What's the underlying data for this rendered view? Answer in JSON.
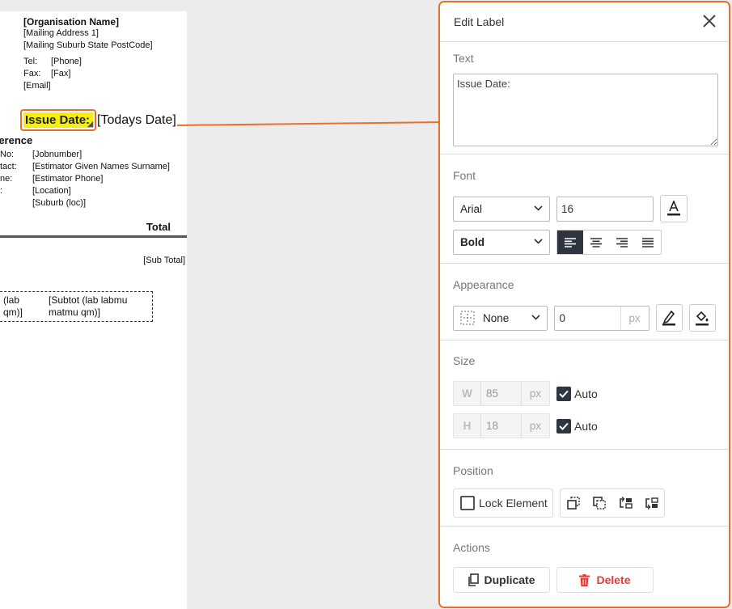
{
  "document": {
    "org_name": "[Organisation Name]",
    "address1": "[Mailing Address 1]",
    "address2": "[Mailing Suburb State PostCode]",
    "tel_label": "Tel:",
    "tel_value": "[Phone]",
    "fax_label": "Fax:",
    "fax_value": "[Fax]",
    "email": "[Email]",
    "issue_label": "Issue Date:",
    "todays_date": "[Todays Date]",
    "reference_title": "ference",
    "reference_rows": [
      {
        "label": "No:",
        "value": "[Jobnumber]"
      },
      {
        "label": "tact:",
        "value": "[Estimator Given Names Surname]"
      },
      {
        "label": "ne:",
        "value": "[Estimator Phone]"
      },
      {
        "label": ":",
        "value": "[Location]"
      },
      {
        "label": "",
        "value": "[Suburb (loc)]"
      }
    ],
    "total_header": "Total",
    "sub_total": "[Sub Total]",
    "dashed_left_1": "(lab",
    "dashed_left_2": "qm)]",
    "dashed_right_1": "[Subtot (lab labmu",
    "dashed_right_2": "matmu qm)]"
  },
  "panel": {
    "title": "Edit Label",
    "text_section": {
      "title": "Text",
      "value": "Issue Date:"
    },
    "font_section": {
      "title": "Font",
      "family": "Arial",
      "size": "16",
      "weight": "Bold",
      "alignment_selected": "left"
    },
    "appearance_section": {
      "title": "Appearance",
      "border": "None",
      "border_width": "0",
      "unit": "px"
    },
    "size_section": {
      "title": "Size",
      "w_label": "W",
      "w_value": "85",
      "h_label": "H",
      "h_value": "18",
      "unit": "px",
      "auto_label": "Auto"
    },
    "position_section": {
      "title": "Position",
      "lock_label": "Lock Element"
    },
    "actions_section": {
      "title": "Actions",
      "duplicate_label": "Duplicate",
      "delete_label": "Delete"
    }
  },
  "colors": {
    "accent": "#e8702a",
    "highlight": "#f5ef10",
    "dark_button": "#2e3440",
    "delete": "#e53935"
  }
}
